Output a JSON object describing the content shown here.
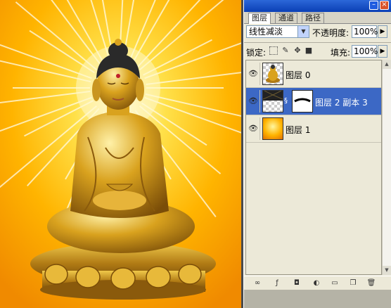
{
  "panel": {
    "tabs": [
      {
        "label": "图层",
        "active": true
      },
      {
        "label": "通道",
        "active": false
      },
      {
        "label": "路径",
        "active": false
      }
    ],
    "blend_mode": "线性减淡",
    "opacity_label": "不透明度:",
    "opacity_value": "100%",
    "lock_label": "锁定:",
    "fill_label": "填充:",
    "fill_value": "100%",
    "layers": [
      {
        "name": "图层 0",
        "visible": true,
        "selected": false,
        "thumbnail": "buddha-statue"
      },
      {
        "name": "图层 2 副本 3",
        "visible": true,
        "selected": true,
        "thumbnail": "dark-rays",
        "has_mask": true
      },
      {
        "name": "图层 1",
        "visible": true,
        "selected": false,
        "thumbnail": "orange-gradient"
      }
    ]
  },
  "icons": {
    "visibility": "eye-icon",
    "lock_transparent": "lock-transparent-icon",
    "lock_paint": "brush-icon",
    "lock_move": "move-icon",
    "lock_all": "padlock-icon",
    "bottom": [
      "link-icon",
      "layer-style-icon",
      "add-mask-icon",
      "adjustment-layer-icon",
      "new-group-icon",
      "new-layer-icon",
      "trash-icon"
    ]
  },
  "colors": {
    "selection": "#3c68c5",
    "title_bar": "#0a3fb5",
    "canvas_background": "#ffb000"
  }
}
